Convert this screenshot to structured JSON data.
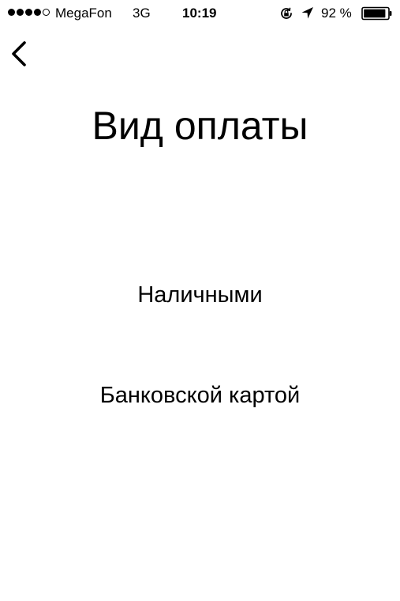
{
  "status_bar": {
    "signal_bars": 4,
    "signal_total": 5,
    "carrier": "MegaFon",
    "network": "3G",
    "time": "10:19",
    "battery_percent": "92 %",
    "battery_level": 0.92,
    "icons": [
      "rotation-lock-icon",
      "location-arrow-icon",
      "battery-icon"
    ]
  },
  "navigation": {
    "back_icon": "chevron-left-icon"
  },
  "page": {
    "title": "Вид оплаты"
  },
  "payment_options": [
    {
      "label": "Наличными"
    },
    {
      "label": "Банковской картой"
    }
  ],
  "colors": {
    "background": "#ffffff",
    "text": "#000000"
  }
}
